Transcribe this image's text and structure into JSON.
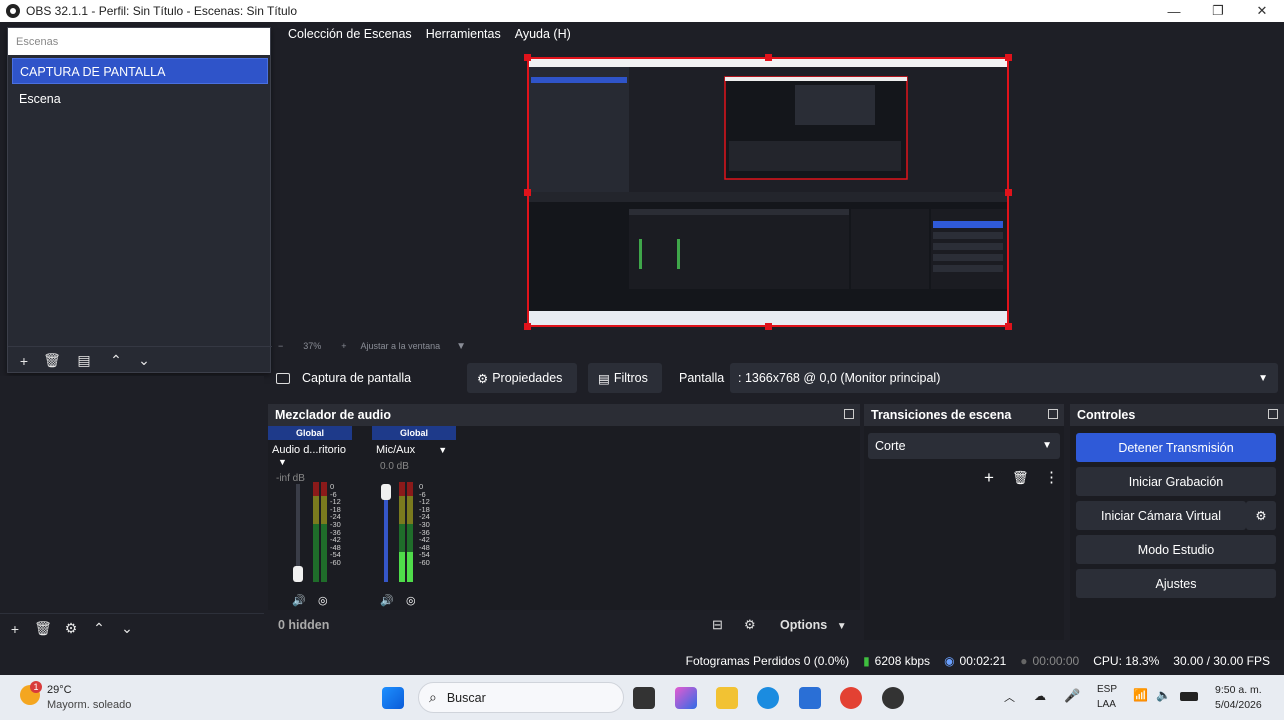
{
  "window": {
    "title": "OBS 32.1.1 - Perfil: Sin Título - Escenas: Sin Título",
    "minimize": "—",
    "maximize": "❐",
    "close": "✕"
  },
  "menu": {
    "items": [
      "Colección de Escenas",
      "Herramientas",
      "Ayuda (H)"
    ]
  },
  "scenes": {
    "search_placeholder": "Escenas",
    "items": [
      "CAPTURA DE PANTALLA",
      "Escena"
    ],
    "active_index": 0
  },
  "preview": {
    "zoom": "37%",
    "fit_label": "Ajustar a la ventana",
    "zoom_minus": "−",
    "zoom_plus": "+"
  },
  "source_toolbar": {
    "source_name": "Captura de pantalla",
    "properties": "Propiedades",
    "filters": "Filtros",
    "display_label": "Pantalla",
    "display_value": ": 1366x768 @ 0,0 (Monitor principal)"
  },
  "mixer": {
    "title": "Mezclador de audio",
    "channels": [
      {
        "tag": "Global",
        "name": "Audio d...ritorio",
        "db": "-inf dB",
        "level": 0.0
      },
      {
        "tag": "Global",
        "name": "Mic/Aux",
        "db": "0.0 dB",
        "level": 1.0
      }
    ],
    "scale": [
      "0",
      "-6",
      "-12",
      "-18",
      "-24",
      "-30",
      "-36",
      "-42",
      "-48",
      "-54",
      "-60"
    ],
    "hidden_label": "0 hidden",
    "options_label": "Options"
  },
  "transitions": {
    "title": "Transiciones de escena",
    "selected": "Corte"
  },
  "controls": {
    "title": "Controles",
    "buttons": [
      "Detener Transmisión",
      "Iniciar Grabación",
      "Iniciar Cámara Virtual",
      "Modo Estudio",
      "Ajustes"
    ]
  },
  "status": {
    "dropped": "Fotogramas Perdidos 0 (0.0%)",
    "bitrate": "6208 kbps",
    "stream_time": "00:02:21",
    "rec_time": "00:00:00",
    "cpu": "CPU: 18.3%",
    "fps": "30.00 / 30.00 FPS"
  },
  "taskbar": {
    "weather_temp": "29°C",
    "weather_desc": "Mayorm. soleado",
    "weather_badge": "1",
    "search_placeholder": "Buscar",
    "lang_top": "ESP",
    "lang_bottom": "LAA",
    "time": "9:50 a. m.",
    "date": "5/04/2026"
  },
  "colors": {
    "accent_blue": "#2f5ad8",
    "selection_red": "#e0131b",
    "panel_bg": "#1b1c22",
    "header_bg": "#2b2d35"
  }
}
